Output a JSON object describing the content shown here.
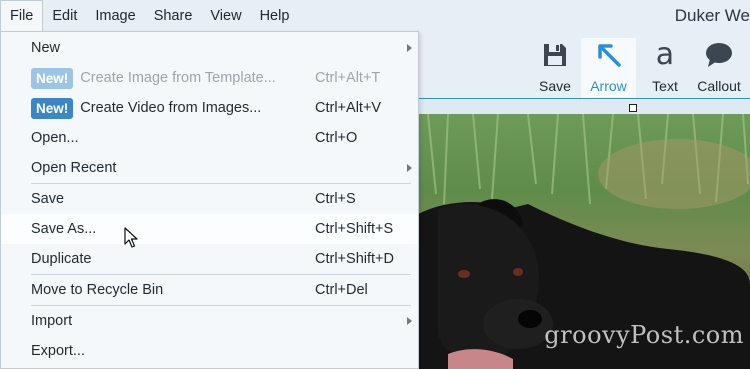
{
  "menubar": {
    "items": [
      "File",
      "Edit",
      "Image",
      "Share",
      "View",
      "Help"
    ],
    "active": "File"
  },
  "window_title": "Duker We",
  "toolbar": {
    "tools": [
      {
        "label": "Save",
        "icon": "save-icon"
      },
      {
        "label": "Arrow",
        "icon": "arrow-icon"
      },
      {
        "label": "Text",
        "icon": "text-icon",
        "glyph": "a"
      },
      {
        "label": "Callout",
        "icon": "callout-icon"
      }
    ],
    "selected": "Arrow",
    "accent": "#2b8fd6"
  },
  "file_menu": {
    "items": [
      {
        "label": "New",
        "shortcut": "",
        "submenu": true
      },
      {
        "badge": "New!",
        "label": "Create Image from Template...",
        "shortcut": "Ctrl+Alt+T",
        "disabled": true
      },
      {
        "badge": "New!",
        "label": "Create Video from Images...",
        "shortcut": "Ctrl+Alt+V"
      },
      {
        "label": "Open...",
        "shortcut": "Ctrl+O"
      },
      {
        "label": "Open Recent",
        "shortcut": "",
        "submenu": true
      },
      {
        "label": "Save",
        "shortcut": "Ctrl+S"
      },
      {
        "label": "Save As...",
        "shortcut": "Ctrl+Shift+S",
        "highlighted": true
      },
      {
        "label": "Duplicate",
        "shortcut": "Ctrl+Shift+D"
      },
      {
        "label": "Move to Recycle Bin",
        "shortcut": "Ctrl+Del"
      },
      {
        "label": "Import",
        "shortcut": "",
        "submenu": true
      },
      {
        "label": "Export...",
        "shortcut": ""
      }
    ],
    "badge_color": "#3a86c8"
  },
  "canvas": {
    "watermark": "groovyPost.com"
  }
}
